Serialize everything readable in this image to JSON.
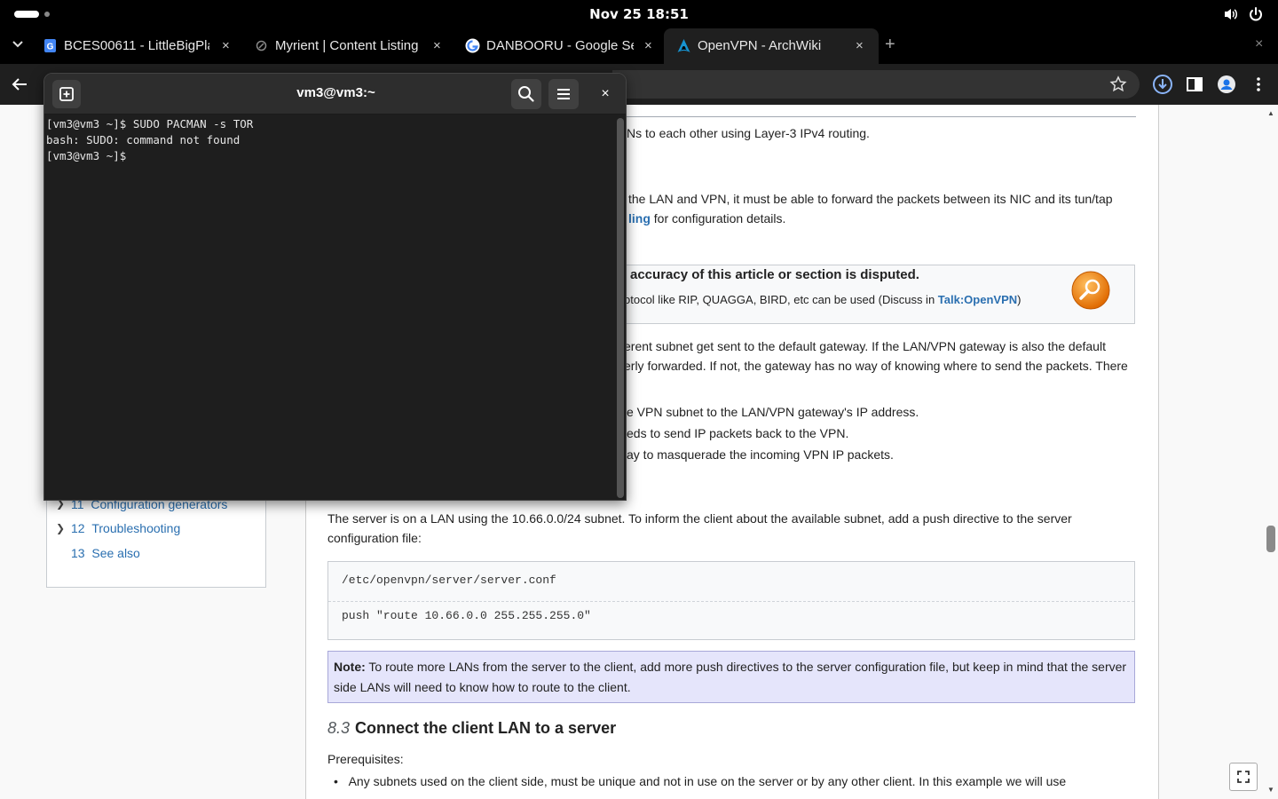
{
  "system": {
    "clock": "Nov 25  18:51"
  },
  "browser": {
    "tabs": [
      {
        "title": "BCES00611 - LittleBigPla",
        "icon": "google-docs-icon",
        "close": "×"
      },
      {
        "title": "Myrient | Content Listing",
        "icon": "myrient-icon",
        "close": "×"
      },
      {
        "title": "DANBOORU - Google Se",
        "icon": "google-icon",
        "close": "×"
      },
      {
        "title": "OpenVPN - ArchWiki",
        "icon": "archlinux-icon",
        "close": "×"
      }
    ],
    "new_tab": "+",
    "window_close": "×"
  },
  "terminal": {
    "title": "vm3@vm3:~",
    "lines": [
      "[vm3@vm3 ~]$ SUDO PACMAN -s TOR",
      "bash: SUDO: command not found",
      "[vm3@vm3 ~]$ "
    ],
    "close": "×"
  },
  "wiki": {
    "p1": "Ns to each other using Layer-3 IPv4 routing.",
    "p2_line1": "the LAN and VPN, it must be able to forward the packets between its NIC and its tun/tap",
    "p2_link": "ling",
    "p2_rest": " for configuration details.",
    "disputed_title": "accuracy of this article or section is disputed.",
    "disputed_body_pre": "otocol like RIP, QUAGGA, BIRD, etc can be used (Discuss in ",
    "disputed_link": "Talk:OpenVPN",
    "disputed_body_post": ")",
    "p3_line1": "erent subnet get sent to the default gateway. If the LAN/VPN gateway is also the default",
    "p3_line2": "erly forwarded. If not, the gateway has no way of knowing where to send the packets. There",
    "li1": "e VPN subnet to the LAN/VPN gateway's IP address.",
    "li2": "eds to send IP packets back to the VPN.",
    "li3": "ay to masquerade the incoming VPN IP packets.",
    "toc": [
      {
        "num": "11",
        "label": "Configuration generators"
      },
      {
        "num": "12",
        "label": "Troubleshooting"
      },
      {
        "num": "13",
        "label": "See also"
      }
    ],
    "p4_line1": "The server is on a LAN using the 10.66.0.0/24 subnet. To inform the client about the available subnet, add a push directive to the server",
    "p4_line2": "configuration file:",
    "code_file": "/etc/openvpn/server/server.conf",
    "code_line": "push \"route 10.66.0.0 255.255.255.0\"",
    "note_label": "Note:",
    "note_text": " To route more LANs from the server to the client, add more push directives to the server configuration file, but keep in mind that the server side LANs will need to know how to route to the client.",
    "section_num": "8.3",
    "section_title": "Connect the client LAN to a server",
    "prereq": "Prerequisites:",
    "bullet1": "Any subnets used on the client side, must be unique and not in use on the server or by any other client. In this example we will use"
  }
}
